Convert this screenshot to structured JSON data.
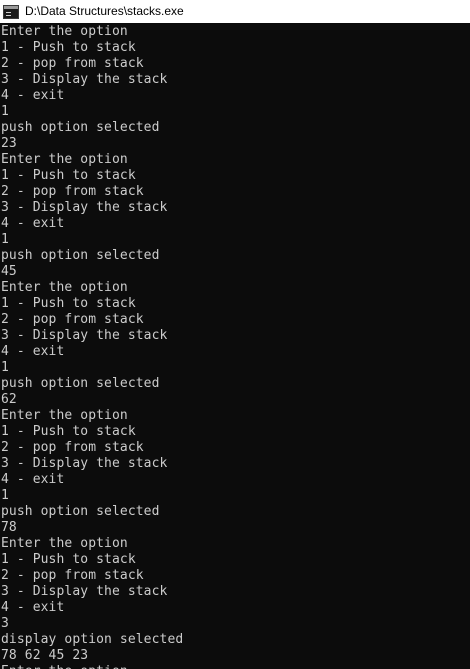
{
  "window": {
    "title": "D:\\Data Structures\\stacks.exe"
  },
  "console": {
    "lines": [
      "Enter the option",
      "1 - Push to stack",
      "2 - pop from stack",
      "3 - Display the stack",
      "4 - exit",
      "1",
      "push option selected",
      "23",
      "Enter the option",
      "1 - Push to stack",
      "2 - pop from stack",
      "3 - Display the stack",
      "4 - exit",
      "1",
      "push option selected",
      "45",
      "Enter the option",
      "1 - Push to stack",
      "2 - pop from stack",
      "3 - Display the stack",
      "4 - exit",
      "1",
      "push option selected",
      "62",
      "Enter the option",
      "1 - Push to stack",
      "2 - pop from stack",
      "3 - Display the stack",
      "4 - exit",
      "1",
      "push option selected",
      "78",
      "Enter the option",
      "1 - Push to stack",
      "2 - pop from stack",
      "3 - Display the stack",
      "4 - exit",
      "3",
      "display option selected",
      "78 62 45 23",
      "Enter the option"
    ]
  }
}
